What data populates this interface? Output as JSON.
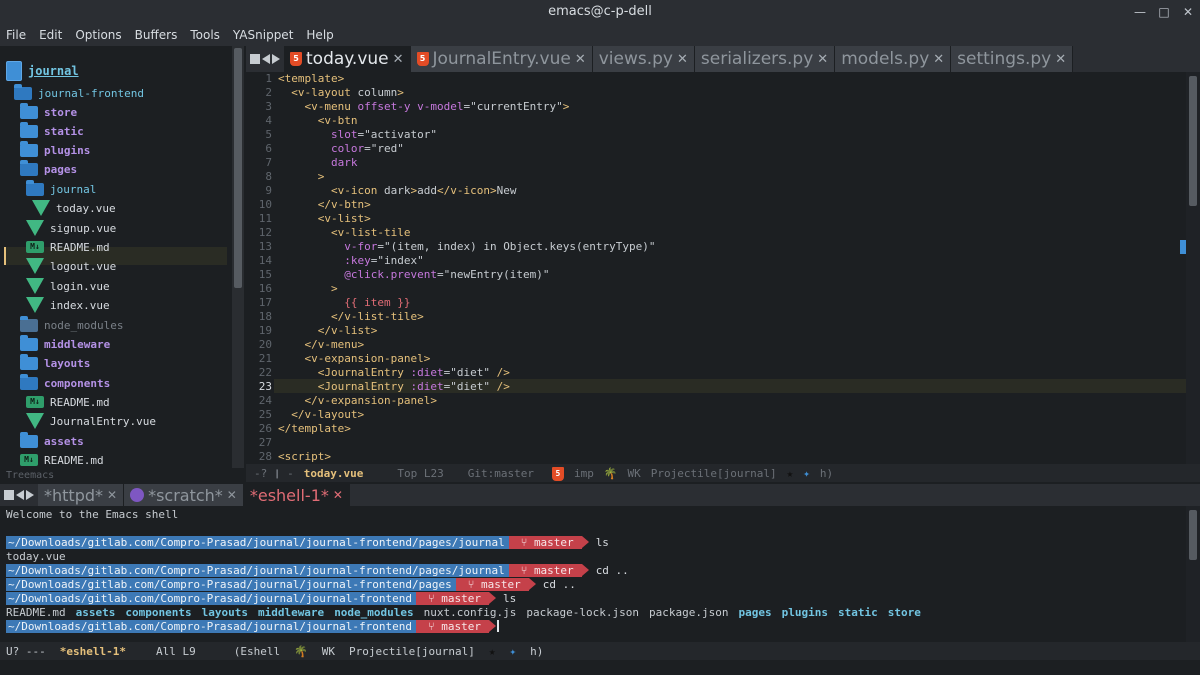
{
  "window": {
    "title": "emacs@c-p-dell"
  },
  "menubar": [
    "File",
    "Edit",
    "Options",
    "Buffers",
    "Tools",
    "YASnippet",
    "Help"
  ],
  "treemacs": {
    "label": "Treemacs",
    "root": "journal",
    "items": [
      {
        "label": "journal-frontend",
        "kind": "dir2"
      },
      {
        "label": "store",
        "kind": "dir"
      },
      {
        "label": "static",
        "kind": "dir"
      },
      {
        "label": "plugins",
        "kind": "dir"
      },
      {
        "label": "pages",
        "kind": "dir"
      },
      {
        "label": "journal",
        "kind": "dir2"
      },
      {
        "label": "today.vue",
        "kind": "vue"
      },
      {
        "label": "signup.vue",
        "kind": "vue"
      },
      {
        "label": "README.md",
        "kind": "md"
      },
      {
        "label": "logout.vue",
        "kind": "vue"
      },
      {
        "label": "login.vue",
        "kind": "vue"
      },
      {
        "label": "index.vue",
        "kind": "vue"
      },
      {
        "label": "node_modules",
        "kind": "grey"
      },
      {
        "label": "middleware",
        "kind": "dir"
      },
      {
        "label": "layouts",
        "kind": "dir"
      },
      {
        "label": "components",
        "kind": "dir"
      },
      {
        "label": "README.md",
        "kind": "md"
      },
      {
        "label": "JournalEntry.vue",
        "kind": "vue"
      },
      {
        "label": "assets",
        "kind": "dir"
      },
      {
        "label": "README.md",
        "kind": "md"
      }
    ]
  },
  "tabs": [
    {
      "label": "today.vue",
      "active": true,
      "icon": "html5-icon"
    },
    {
      "label": "JournalEntry.vue",
      "active": false,
      "icon": "html5-icon"
    },
    {
      "label": "views.py",
      "active": false
    },
    {
      "label": "serializers.py",
      "active": false
    },
    {
      "label": "models.py",
      "active": false
    },
    {
      "label": "settings.py",
      "active": false
    }
  ],
  "editor": {
    "lines": [
      "<template>",
      "  <v-layout column>",
      "    <v-menu offset-y v-model=\"currentEntry\">",
      "      <v-btn",
      "        slot=\"activator\"",
      "        color=\"red\"",
      "        dark",
      "      >",
      "        <v-icon dark>add</v-icon>New",
      "      </v-btn>",
      "      <v-list>",
      "        <v-list-tile",
      "          v-for=\"(item, index) in Object.keys(entryType)\"",
      "          :key=\"index\"",
      "          @click.prevent=\"newEntry(item)\"",
      "        >",
      "          {{ item }}",
      "        </v-list-tile>",
      "      </v-list>",
      "    </v-menu>",
      "    <v-expansion-panel>",
      "      <JournalEntry :diet=\"diet\" />",
      "      <JournalEntry :diet=\"diet\" />",
      "    </v-expansion-panel>",
      "  </v-layout>",
      "</template>",
      "",
      "<script>"
    ],
    "current_line": 23
  },
  "modeline_top": {
    "state": "-? ❙ -",
    "buffer": "today.vue",
    "position": "Top L23",
    "vc": "Git:master",
    "mode": "imp",
    "extras": "WK",
    "projectile": "Projectile[journal]",
    "tail": "h)"
  },
  "eshell_tabs": [
    {
      "label": "*httpd*",
      "active": false
    },
    {
      "label": "*scratch*",
      "active": false,
      "icon": "emacs-icon"
    },
    {
      "label": "*eshell-1*",
      "active": true
    }
  ],
  "eshell": {
    "welcome": "Welcome to the Emacs shell",
    "prompts": [
      {
        "path": "~/Downloads/gitlab.com/Compro-Prasad/journal/journal-frontend/pages/journal",
        "branch": "master",
        "cmd": "ls"
      },
      {
        "path": "~/Downloads/gitlab.com/Compro-Prasad/journal/journal-frontend/pages/journal",
        "branch": "master",
        "cmd": "cd .."
      },
      {
        "path": "~/Downloads/gitlab.com/Compro-Prasad/journal/journal-frontend/pages",
        "branch": "master",
        "cmd": "cd .."
      },
      {
        "path": "~/Downloads/gitlab.com/Compro-Prasad/journal/journal-frontend",
        "branch": "master",
        "cmd": "ls"
      },
      {
        "path": "~/Downloads/gitlab.com/Compro-Prasad/journal/journal-frontend",
        "branch": "master",
        "cmd": ""
      }
    ],
    "output1": "today.vue",
    "ls_output": [
      {
        "name": "README.md",
        "dir": false
      },
      {
        "name": "assets",
        "dir": true
      },
      {
        "name": "components",
        "dir": true
      },
      {
        "name": "layouts",
        "dir": true
      },
      {
        "name": "middleware",
        "dir": true
      },
      {
        "name": "node_modules",
        "dir": true
      },
      {
        "name": "nuxt.config.js",
        "dir": false
      },
      {
        "name": "package-lock.json",
        "dir": false
      },
      {
        "name": "package.json",
        "dir": false
      },
      {
        "name": "pages",
        "dir": true
      },
      {
        "name": "plugins",
        "dir": true
      },
      {
        "name": "static",
        "dir": true
      },
      {
        "name": "store",
        "dir": true
      }
    ]
  },
  "modeline_bottom": {
    "state": "U? ---",
    "buffer": "*eshell-1*",
    "position": "All L9",
    "mode": "(Eshell",
    "extras": "WK",
    "projectile": "Projectile[journal]",
    "tail": "h)"
  },
  "colors": {
    "bg": "#1c1f22",
    "tag": "#e5c07b",
    "attr": "#c678dd",
    "path_seg": "#3d79b6",
    "branch_seg": "#c5414a"
  }
}
